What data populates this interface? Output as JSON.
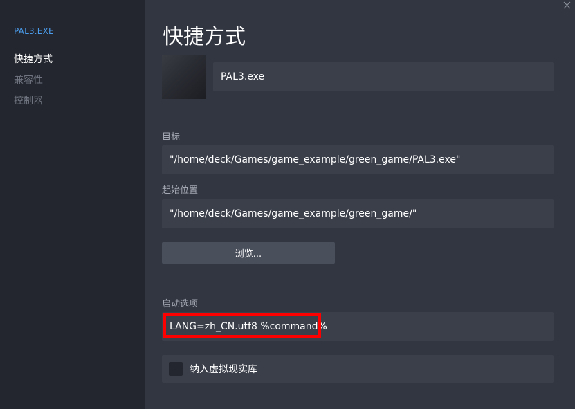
{
  "sidebar": {
    "game_title": "PAL3.EXE",
    "items": [
      {
        "label": "快捷方式",
        "active": true
      },
      {
        "label": "兼容性",
        "active": false
      },
      {
        "label": "控制器",
        "active": false
      }
    ]
  },
  "main": {
    "title": "快捷方式",
    "shortcut_name": "PAL3.exe",
    "target_label": "目标",
    "target_value": "\"/home/deck/Games/game_example/green_game/PAL3.exe\"",
    "start_in_label": "起始位置",
    "start_in_value": "\"/home/deck/Games/game_example/green_game/\"",
    "browse_label": "浏览...",
    "launch_options_label": "启动选项",
    "launch_options_value": "LANG=zh_CN.utf8 %command%",
    "vr_library_label": "纳入虚拟现实库",
    "vr_library_checked": false
  },
  "icons": {
    "close": "close-icon"
  },
  "colors": {
    "accent": "#4b9cec",
    "highlight": "#ff0000",
    "sidebar_bg": "#23262e",
    "main_bg": "#323641",
    "field_bg": "#3b3f4a"
  }
}
